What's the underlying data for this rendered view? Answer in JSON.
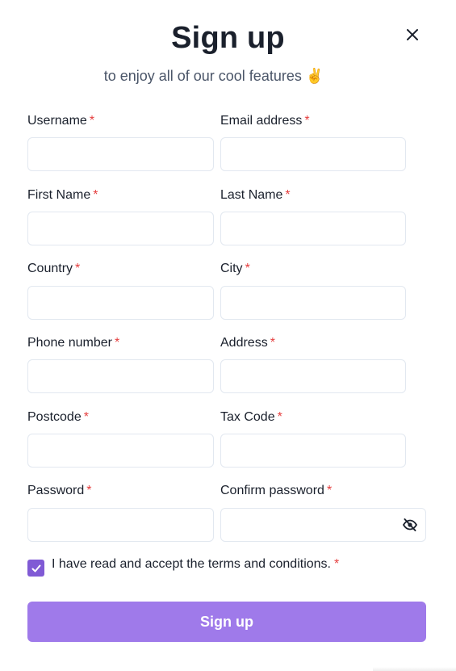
{
  "header": {
    "title": "Sign up",
    "subtitle": "to enjoy all of our cool features",
    "subtitle_emoji": "✌️",
    "close_icon": "close-icon"
  },
  "form": {
    "required_marker": "*",
    "fields": {
      "username": {
        "label": "Username",
        "value": ""
      },
      "email": {
        "label": "Email address",
        "value": ""
      },
      "first_name": {
        "label": "First Name",
        "value": ""
      },
      "last_name": {
        "label": "Last Name",
        "value": ""
      },
      "country": {
        "label": "Country",
        "value": ""
      },
      "city": {
        "label": "City",
        "value": ""
      },
      "phone": {
        "label": "Phone number",
        "value": ""
      },
      "address": {
        "label": "Address",
        "value": ""
      },
      "postcode": {
        "label": "Postcode",
        "value": ""
      },
      "tax_code": {
        "label": "Tax Code",
        "value": ""
      },
      "password": {
        "label": "Password",
        "value": ""
      },
      "confirm_password": {
        "label": "Confirm password",
        "value": "",
        "toggle_icon": "eye-off-icon"
      }
    },
    "terms": {
      "label": "I have read and accept the terms and conditions.",
      "checked": true
    },
    "submit_label": "Sign up"
  },
  "colors": {
    "accent": "#805ad5",
    "button": "#9f7aea",
    "required": "#e53e3e",
    "text": "#1a202c",
    "muted": "#4a5568",
    "border": "#e2e8f0"
  }
}
